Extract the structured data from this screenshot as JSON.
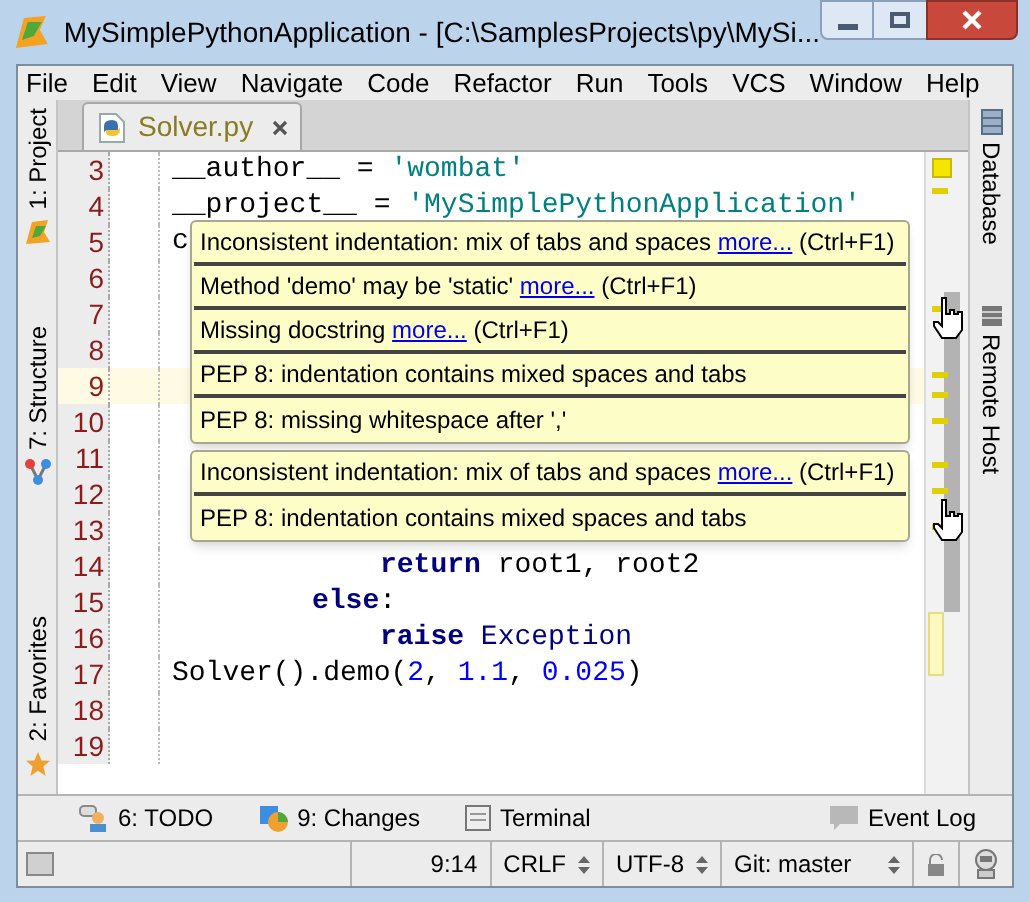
{
  "window": {
    "title": "MySimplePythonApplication - [C:\\SamplesProjects\\py\\MySi..."
  },
  "menu": [
    {
      "label": "File"
    },
    {
      "label": "Edit"
    },
    {
      "label": "View"
    },
    {
      "label": "Navigate"
    },
    {
      "label": "Code"
    },
    {
      "label": "Refactor"
    },
    {
      "label": "Run"
    },
    {
      "label": "Tools"
    },
    {
      "label": "VCS"
    },
    {
      "label": "Window"
    },
    {
      "label": "Help"
    }
  ],
  "left_tool_windows": [
    {
      "label": "1: Project",
      "kind": "project"
    },
    {
      "label": "7: Structure",
      "kind": "structure"
    },
    {
      "label": "2: Favorites",
      "kind": "favorites"
    }
  ],
  "right_tool_windows": [
    {
      "label": "Database",
      "kind": "database"
    },
    {
      "label": "Remote Host",
      "kind": "remote"
    }
  ],
  "tabs": [
    {
      "label": "Solver.py",
      "selected": true
    }
  ],
  "editor": {
    "lines": [
      {
        "number": "3",
        "current": false,
        "tokens": [
          {
            "kind": "plain",
            "text": "__author__ = "
          },
          {
            "kind": "string",
            "text": "'wombat'"
          }
        ]
      },
      {
        "number": "4",
        "current": false,
        "tokens": [
          {
            "kind": "plain",
            "text": "__project__ = "
          },
          {
            "kind": "string",
            "text": "'MySimplePythonApplication'"
          }
        ]
      },
      {
        "number": "5",
        "current": false,
        "tokens": [
          {
            "kind": "plain",
            "text": "c"
          }
        ]
      },
      {
        "number": "6",
        "current": false
      },
      {
        "number": "7",
        "current": false
      },
      {
        "number": "8",
        "current": false
      },
      {
        "number": "9",
        "current": true
      },
      {
        "number": "10",
        "current": false
      },
      {
        "number": "11",
        "current": false
      },
      {
        "number": "12",
        "current": false
      },
      {
        "number": "13",
        "current": false
      },
      {
        "number": "14",
        "current": false,
        "kind": "nested",
        "tokens": [
          {
            "kind": "keyword",
            "text": "return"
          },
          {
            "kind": "plain",
            "text": " root1, root2"
          }
        ]
      },
      {
        "number": "15",
        "current": false,
        "kind": "block",
        "tokens": [
          {
            "kind": "keyword",
            "text": "else"
          },
          {
            "kind": "plain",
            "text": ":"
          }
        ]
      },
      {
        "number": "16",
        "current": false,
        "kind": "nested",
        "tokens": [
          {
            "kind": "keyword",
            "text": "raise"
          },
          {
            "kind": "builtin",
            "text": " Exception"
          }
        ]
      },
      {
        "number": "17",
        "current": false,
        "tokens": [
          {
            "kind": "plain",
            "text": "Solver().demo("
          },
          {
            "kind": "number",
            "text": "2"
          },
          {
            "kind": "plain",
            "text": ", "
          },
          {
            "kind": "number",
            "text": "1.1"
          },
          {
            "kind": "plain",
            "text": ", "
          },
          {
            "kind": "number",
            "text": "0.025"
          },
          {
            "kind": "plain",
            "text": ")"
          }
        ]
      },
      {
        "number": "18",
        "current": false
      },
      {
        "number": "19",
        "current": false
      }
    ]
  },
  "tooltips": [
    {
      "messages": [
        {
          "text": "Inconsistent indentation: mix of tabs and spaces",
          "link": "more...",
          "shortcut": "(Ctrl+F1)"
        },
        {
          "text": "Method 'demo' may be 'static'",
          "link": "more...",
          "shortcut": "(Ctrl+F1)"
        },
        {
          "text": "Missing docstring",
          "link": "more...",
          "shortcut": "(Ctrl+F1)"
        },
        {
          "text": "PEP 8: indentation contains mixed spaces and tabs"
        },
        {
          "text": "PEP 8: missing whitespace after ','"
        }
      ]
    },
    {
      "messages": [
        {
          "text": "Inconsistent indentation: mix of tabs and spaces",
          "link": "more...",
          "shortcut": "(Ctrl+F1)"
        },
        {
          "text": "PEP 8: indentation contains mixed spaces and tabs"
        }
      ]
    }
  ],
  "bottom_tool_windows": [
    {
      "label": "6: TODO",
      "kind": "todo"
    },
    {
      "label": "9: Changes",
      "kind": "changes"
    },
    {
      "label": "Terminal",
      "kind": "terminal"
    },
    {
      "label": "Event Log",
      "kind": "eventlog"
    }
  ],
  "status_bar": {
    "position": "9:14",
    "line_separator": "CRLF",
    "encoding": "UTF-8",
    "vcs": "Git: master"
  }
}
